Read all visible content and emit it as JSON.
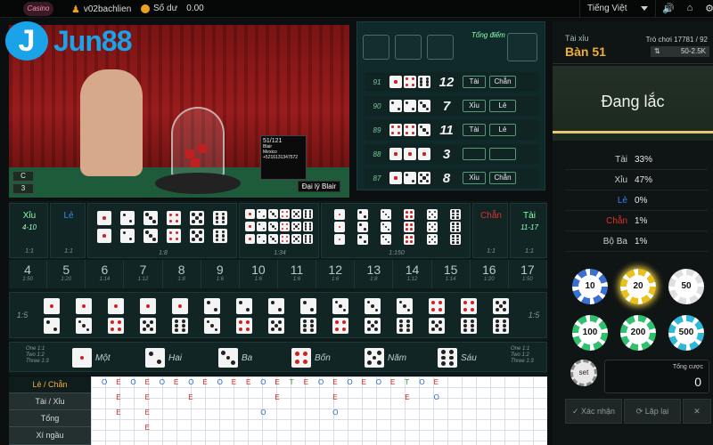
{
  "topbar": {
    "logo_text": "Casino",
    "username": "v02bachlien",
    "balance_label": "Số dư",
    "balance": "0.00",
    "language": "Tiếng Việt"
  },
  "brand": {
    "initial": "J",
    "name": "Jun88"
  },
  "video": {
    "dealer_label": "Đại lý Blair",
    "sign_line1": "51/121",
    "sign_line2": "Blair",
    "sign_line3": "Mexico",
    "sign_line4": "+5216131347572",
    "control_top": "C",
    "control_bottom": "3"
  },
  "results": {
    "total_label": "Tổng điểm",
    "rows": [
      {
        "id": "91",
        "dice": [
          1,
          4,
          6
        ],
        "sum": "12",
        "t1": "Tài",
        "t2": "Chẵn"
      },
      {
        "id": "90",
        "dice": [
          2,
          2,
          3
        ],
        "sum": "7",
        "t1": "Xỉu",
        "t2": "Lẻ"
      },
      {
        "id": "89",
        "dice": [
          4,
          4,
          3
        ],
        "sum": "11",
        "t1": "Tài",
        "t2": "Lẻ"
      },
      {
        "id": "88",
        "dice": [
          1,
          1,
          1
        ],
        "sum": "3",
        "t1": "",
        "t2": ""
      },
      {
        "id": "87",
        "dice": [
          1,
          2,
          5
        ],
        "sum": "8",
        "t1": "Xỉu",
        "t2": "Chẵn"
      }
    ]
  },
  "table_info": {
    "game_type": "Tài xỉu",
    "table_name": "Bàn 51",
    "round_text": "Trò chơi 17781 / 92",
    "limit": "50-2.5K"
  },
  "status": "Đang lắc",
  "stats": [
    {
      "label": "Tài",
      "value": "33%",
      "color": "#c8d0d0"
    },
    {
      "label": "Xỉu",
      "value": "47%",
      "color": "#c8d0d0"
    },
    {
      "label": "Lẻ",
      "value": "0%",
      "color": "#3b82f6"
    },
    {
      "label": "Chẵn",
      "value": "1%",
      "color": "#e23030"
    },
    {
      "label": "Bộ Ba",
      "value": "1%",
      "color": "#c8d0d0"
    }
  ],
  "chips": [
    {
      "value": "10",
      "color": "#3b6fd0"
    },
    {
      "value": "20",
      "color": "#e8c020"
    },
    {
      "value": "50",
      "color": "#e0e0e0"
    },
    {
      "value": "100",
      "color": "#30c070"
    },
    {
      "value": "200",
      "color": "#30c070"
    },
    {
      "value": "500",
      "color": "#30b8d8"
    }
  ],
  "set_chip": "set",
  "total_bet": {
    "label": "Tổng cược",
    "value": "0"
  },
  "buttons": {
    "confirm": "Xác nhận",
    "reroll": "Lặp lại",
    "cancel": "✕"
  },
  "board": {
    "xiu": {
      "label": "Xỉu",
      "range": "4-10",
      "odds": "1:1"
    },
    "le": {
      "label": "Lẻ",
      "odds": "1:1"
    },
    "chan": {
      "label": "Chẵn",
      "odds": "1:1"
    },
    "tai": {
      "label": "Tài",
      "range": "11-17",
      "odds": "1:1"
    },
    "triple_odds": "1:8",
    "any_triple_odds": "1:34",
    "specific_triple_odds": "1:150",
    "sums": [
      {
        "n": "4",
        "o": "1:50"
      },
      {
        "n": "5",
        "o": "1:20"
      },
      {
        "n": "6",
        "o": "1:14"
      },
      {
        "n": "7",
        "o": "1:12"
      },
      {
        "n": "8",
        "o": "1:8"
      },
      {
        "n": "9",
        "o": "1:6"
      },
      {
        "n": "10",
        "o": "1:6"
      },
      {
        "n": "11",
        "o": "1:6"
      },
      {
        "n": "12",
        "o": "1:6"
      },
      {
        "n": "13",
        "o": "1:8"
      },
      {
        "n": "14",
        "o": "1:12"
      },
      {
        "n": "15",
        "o": "1:14"
      },
      {
        "n": "16",
        "o": "1:20"
      },
      {
        "n": "17",
        "o": "1:50"
      }
    ],
    "pair_odds": "1:5",
    "singles": [
      "Một",
      "Hai",
      "Ba",
      "Bốn",
      "Năm",
      "Sáu"
    ],
    "single_odds": [
      "One 1:1",
      "Two 1:2",
      "Three 1:3"
    ]
  },
  "grid": {
    "labels": [
      "Lẻ / Chẵn",
      "Tài / Xỉu",
      "Tổng",
      "Xí ngầu"
    ],
    "row1": [
      "O",
      "E",
      "O",
      "E",
      "O",
      "E",
      "O",
      "E",
      "O",
      "E",
      "E",
      "O",
      "E",
      "T",
      "E",
      "O",
      "E",
      "O",
      "E",
      "O",
      "E",
      "T",
      "O",
      "E"
    ],
    "row2": [
      "",
      "E",
      "",
      "E",
      "",
      "",
      "E",
      "",
      "",
      "",
      "",
      "",
      "E",
      "",
      "",
      "",
      "E",
      "",
      "",
      "",
      "",
      "E",
      "",
      "O"
    ],
    "row3": [
      "",
      "E",
      "",
      "E",
      "",
      "",
      "",
      "",
      "",
      "",
      "",
      "O",
      "",
      "",
      "",
      "",
      "O"
    ],
    "row4": [
      "",
      "",
      "",
      "E"
    ]
  }
}
